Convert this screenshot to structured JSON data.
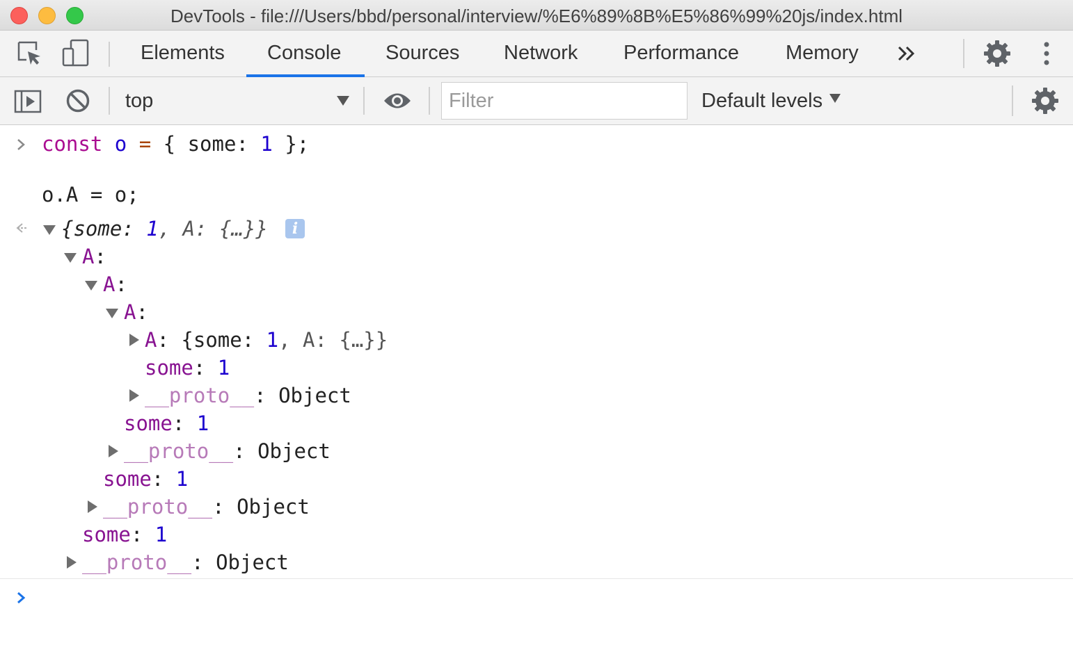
{
  "window": {
    "title": "DevTools - file:///Users/bbd/personal/interview/%E6%89%8B%E5%86%99%20js/index.html"
  },
  "tabbar": {
    "icons": [
      "inspect-element-icon",
      "device-toolbar-icon",
      "more-tabs-chevron-icon",
      "settings-gear-icon",
      "kebab-menu-icon"
    ],
    "tabs": [
      {
        "label": "Elements"
      },
      {
        "label": "Console"
      },
      {
        "label": "Sources"
      },
      {
        "label": "Network"
      },
      {
        "label": "Performance"
      },
      {
        "label": "Memory"
      }
    ],
    "active_tab": "Console",
    "more_label": "»",
    "accent_color": "#1a73e8"
  },
  "toolbar": {
    "context": "top",
    "filter_placeholder": "Filter",
    "filter_value": "",
    "levels": "Default levels"
  },
  "console": {
    "input": {
      "line1": {
        "kw": "const",
        "var": "o",
        "eq": "=",
        "open": "{",
        "key": "some",
        "colon": ":",
        "val": "1",
        "close": "};"
      },
      "line2": "o.A = o;"
    },
    "result": {
      "summary_open": "{some: ",
      "summary_num": "1",
      "summary_rest": ", A: {…}}",
      "info": "i",
      "tree": {
        "A1": "A",
        "A2": "A",
        "A3": "A",
        "A4_key": "A",
        "A4_preview_open": "{some: ",
        "A4_preview_num": "1",
        "A4_preview_rest": ", A: {…}}",
        "some_key": "some",
        "some_val": "1",
        "proto_key": "__proto__",
        "proto_val": "Object",
        "colon": ":"
      }
    },
    "prompt_symbol": "›"
  },
  "colors": {
    "keyword": "#aa0d91",
    "variable": "#1c00cf",
    "property": "#881391",
    "number": "#1c00cf",
    "proto": "#b77ab8"
  }
}
